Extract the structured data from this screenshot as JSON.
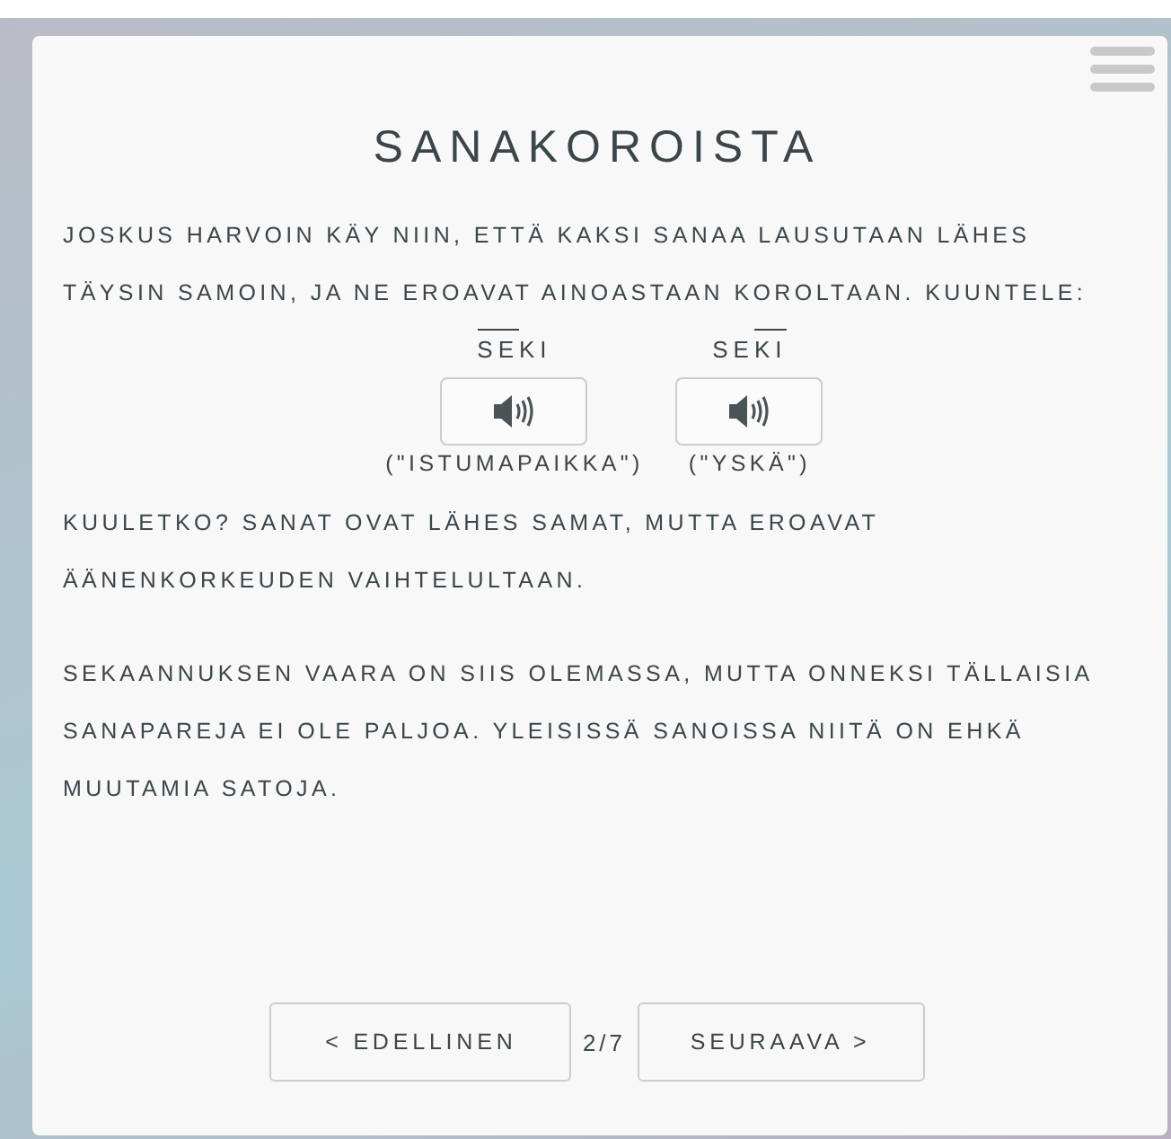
{
  "title": "SANAKOROISTA",
  "intro": "JOSKUS HARVOIN KÄY NIIN, ETTÄ KAKSI SANAA LAUSUTAAN LÄHES TÄYSIN SAMOIN, JA NE EROAVAT AINOASTAAN KOROLTAAN. KUUNTELE:",
  "examples": [
    {
      "syllables": [
        {
          "text": "SE",
          "high": true
        },
        {
          "text": "KI",
          "high": false
        }
      ],
      "meaning": "(\"ISTUMAPAIKKA\")"
    },
    {
      "syllables": [
        {
          "text": "SE",
          "high": false
        },
        {
          "text": "KI",
          "high": true
        }
      ],
      "meaning": "(\"YSKÄ\")"
    }
  ],
  "paragraphs": [
    "KUULETKO? SANAT OVAT LÄHES SAMAT, MUTTA EROAVAT ÄÄNENKORKEUDEN VAIHTELULTAAN.",
    "SEKAANNUKSEN VAARA ON SIIS OLEMASSA, MUTTA ONNEKSI TÄLLAISIA SANAPAREJA EI OLE PALJOA. YLEISISSÄ SANOISSA NIITÄ ON EHKÄ MUUTAMIA SATOJA."
  ],
  "nav": {
    "previous": "< EDELLINEN",
    "page": "2/7",
    "next": "SEURAAVA >"
  }
}
